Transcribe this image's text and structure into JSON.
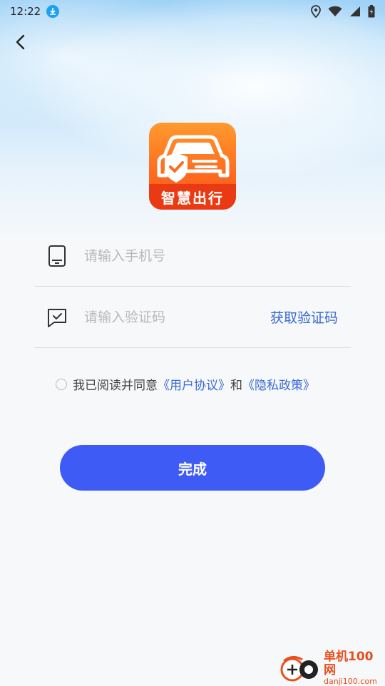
{
  "status_bar": {
    "time": "12:22",
    "icons": [
      "download-icon",
      "location-icon",
      "wifi-icon",
      "signal-icon",
      "battery-icon"
    ]
  },
  "nav": {
    "back_icon": "chevron-left-icon"
  },
  "logo": {
    "text": "智慧出行",
    "colors": {
      "top": "#ff9a2e",
      "band": "#ea3a14"
    }
  },
  "phone_field": {
    "icon": "phone-icon",
    "placeholder": "请输入手机号",
    "value": ""
  },
  "code_field": {
    "icon": "message-check-icon",
    "placeholder": "请输入验证码",
    "value": "",
    "get_code_label": "获取验证码"
  },
  "agreement": {
    "prefix": "我已阅读并同意",
    "user_agreement": "《用户协议》",
    "conjunction": "和",
    "privacy_policy": "《隐私政策》",
    "checked": false
  },
  "submit": {
    "label": "完成"
  },
  "watermark": {
    "name": "单机100网",
    "domain": "danji100.com"
  },
  "colors": {
    "accent": "#3f5bf5",
    "link": "#3769d4",
    "placeholder": "#b8b8b8"
  }
}
